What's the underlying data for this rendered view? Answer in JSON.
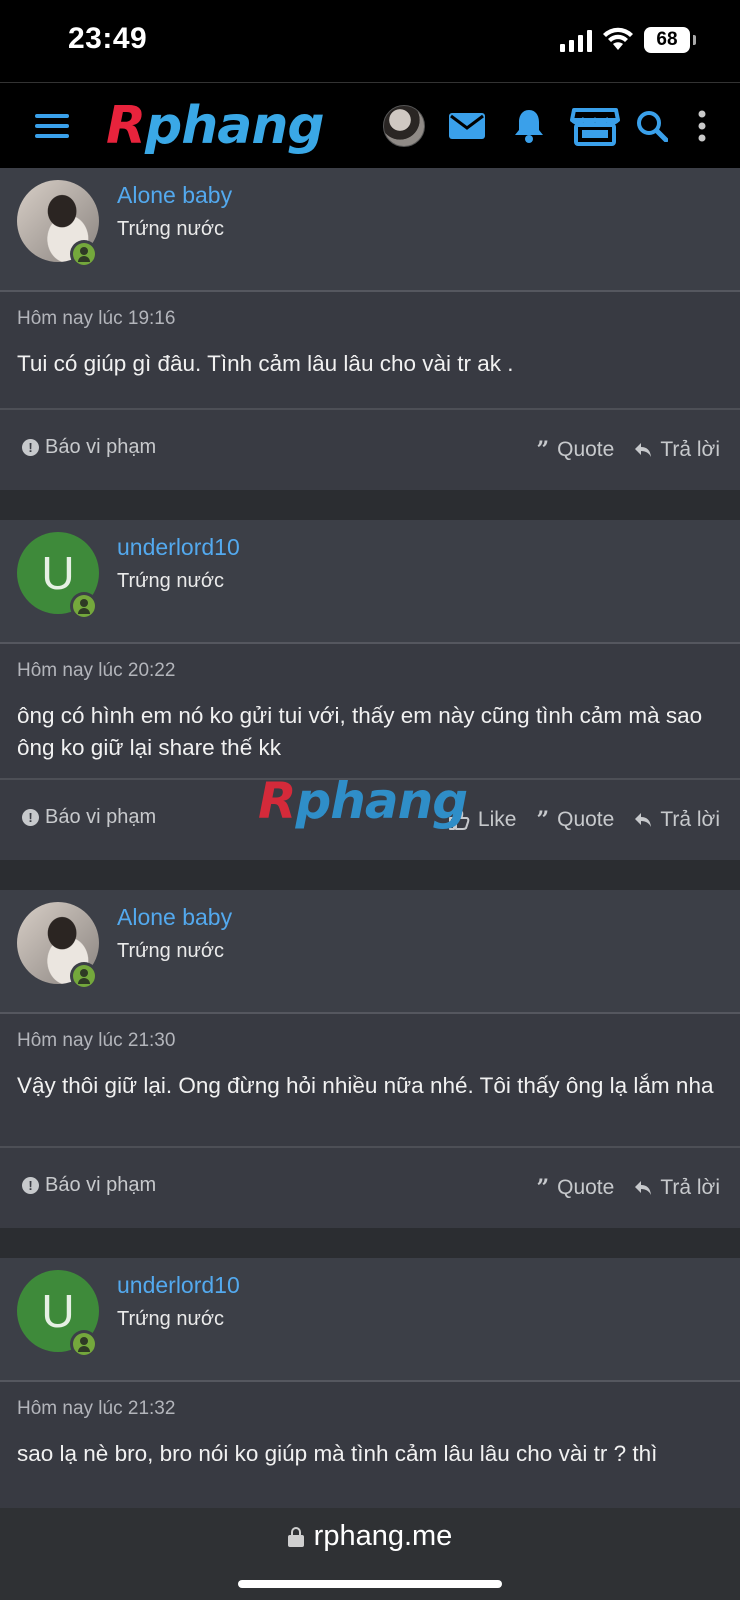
{
  "status_bar": {
    "time": "23:49",
    "battery": "68"
  },
  "header": {
    "logo_part1": "R",
    "logo_part2": "phang",
    "icons": [
      "menu-icon",
      "avatar",
      "mail-icon",
      "bell-icon",
      "store-icon",
      "search-icon",
      "more-vertical-icon"
    ]
  },
  "colors": {
    "accent_blue": "#53a9ee",
    "logo_red": "#e8233c",
    "logo_blue": "#3aa8e6",
    "online_green": "#74a83c",
    "avatar_green": "#3e8a3a"
  },
  "posts": [
    {
      "username": "Alone baby",
      "user_title": "Trứng nước",
      "avatar_type": "photo",
      "date": "Hôm nay lúc 19:16",
      "message": "Tui có giúp gì đâu. Tình cảm lâu lâu cho vài tr ak .",
      "report": "Báo vi phạm",
      "quote": "Quote",
      "reply": "Trả lời"
    },
    {
      "username": "underlord10",
      "user_title": "Trứng nước",
      "avatar_type": "letter",
      "avatar_letter": "U",
      "date": "Hôm nay lúc 20:22",
      "message": "ông có hình em nó ko gửi tui với, thấy em này cũng tình cảm mà sao ông ko giữ lại share thế kk",
      "report": "Báo vi phạm",
      "like": "Like",
      "quote": "Quote",
      "reply": "Trả lời"
    },
    {
      "username": "Alone baby",
      "user_title": "Trứng nước",
      "avatar_type": "photo",
      "date": "Hôm nay lúc 21:30",
      "message": "Vậy thôi giữ lại. Ong đừng hỏi nhiều nữa nhé. Tôi thấy ông lạ lắm nha",
      "report": "Báo vi phạm",
      "quote": "Quote",
      "reply": "Trả lời"
    },
    {
      "username": "underlord10",
      "user_title": "Trứng nước",
      "avatar_type": "letter",
      "avatar_letter": "U",
      "date": "Hôm nay lúc 21:32",
      "message": "sao lạ nè bro, bro nói ko giúp mà tình cảm lâu lâu cho vài tr ? thì"
    }
  ],
  "watermark": {
    "part1": "R",
    "part2": "phang"
  },
  "url_bar": {
    "url": "rphang.me"
  }
}
